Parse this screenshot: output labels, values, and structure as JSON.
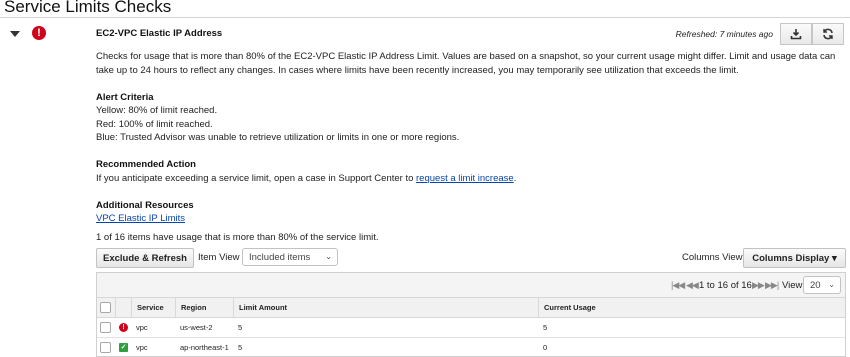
{
  "page": {
    "title": "Service Limits Checks"
  },
  "check": {
    "title": "EC2-VPC Elastic IP Address",
    "refreshed": "Refreshed: 7 minutes ago",
    "status_icon": "red-exclamation-circle-icon",
    "description": "Checks for usage that is more than 80% of the EC2-VPC Elastic IP Address Limit. Values are based on a snapshot, so your current usage might differ. Limit and usage data can take up to 24 hours to reflect any changes. In cases where limits have been recently increased, you may temporarily see utilization that exceeds the limit."
  },
  "alert_criteria": {
    "heading": "Alert Criteria",
    "yellow": "Yellow: 80% of limit reached.",
    "red": "Red: 100% of limit reached.",
    "blue": "Blue: Trusted Advisor was unable to retrieve utilization or limits in one or more regions."
  },
  "recommended_action": {
    "heading": "Recommended Action",
    "text_before": "If you anticipate exceeding a service limit, open a case in Support Center to ",
    "link": "request a limit increase",
    "text_after": "."
  },
  "additional_resources": {
    "heading": "Additional Resources",
    "link": "VPC Elastic IP Limits"
  },
  "summary": "1 of 16 items have usage that is more than 80% of the service limit.",
  "toolbar": {
    "exclude_refresh": "Exclude & Refresh",
    "item_view_label": "Item View",
    "item_view_value": "Included items",
    "columns_view_label": "Columns View",
    "columns_display": "Columns Display ▾"
  },
  "pager": {
    "range": "1 to 16 of 16",
    "view_label": "View",
    "page_size": "20"
  },
  "table": {
    "columns": [
      "Service",
      "Region",
      "Limit Amount",
      "Current Usage"
    ],
    "rows": [
      {
        "status": "red",
        "service": "vpc",
        "region": "us-west-2",
        "limit": "5",
        "usage": "5"
      },
      {
        "status": "green",
        "service": "vpc",
        "region": "ap-northeast-1",
        "limit": "5",
        "usage": "0"
      }
    ]
  },
  "colors": {
    "red": "#d0021b",
    "green": "#2e9e3e",
    "link": "#0645ad"
  }
}
